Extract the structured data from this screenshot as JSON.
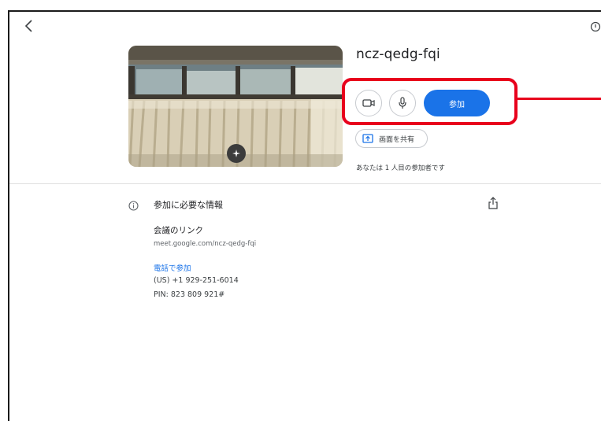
{
  "meeting": {
    "code": "ncz-qedg-fqi",
    "join_label": "参加",
    "share_label": "画面を共有",
    "participants_text": "あなたは 1 人目の参加者です"
  },
  "info": {
    "heading": "参加に必要な情報",
    "link_label": "会議のリンク",
    "link_url": "meet.google.com/ncz-qedg-fqi",
    "phone_link": "電話で参加",
    "phone_number": "(US) +1 929-251-6014",
    "pin": "PIN: 823 809 921#"
  },
  "icons": {
    "back": "chevron-left-icon",
    "camera": "camera-icon",
    "mic": "mic-icon",
    "share_screen": "present-icon",
    "info": "info-icon",
    "share": "share-icon",
    "effects": "sparkle-icon"
  },
  "colors": {
    "accent": "#1a73e8",
    "highlight": "#e8001c"
  }
}
